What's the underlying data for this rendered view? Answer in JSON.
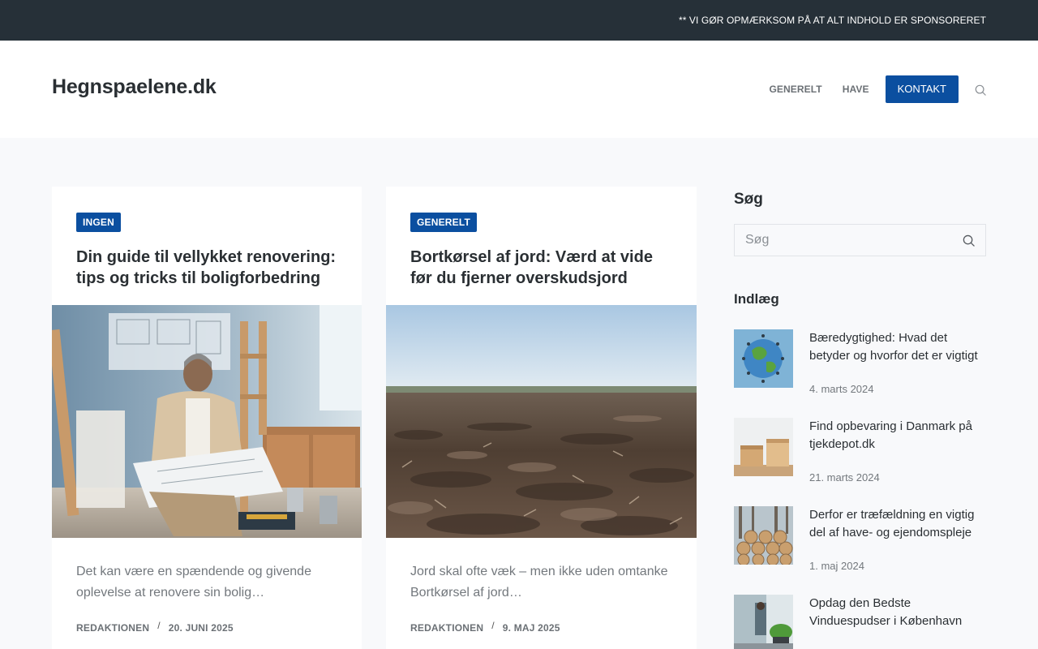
{
  "topbar": {
    "notice": "** VI GØR OPMÆRKSOM PÅ AT ALT INDHOLD ER SPONSORERET"
  },
  "header": {
    "logo": "Hegnspaelene.dk",
    "nav": [
      {
        "label": "GENERELT"
      },
      {
        "label": "HAVE"
      }
    ],
    "contact_label": "KONTAKT",
    "search_icon": "search-icon"
  },
  "posts": [
    {
      "category": "INGEN",
      "title": "Din guide til vellykket renovering: tips og tricks til boligforbedring",
      "excerpt": "Det kan være en spændende og givende oplevelse at renovere sin bolig…",
      "author": "REDAKTIONEN",
      "date": "20. JUNI 2025"
    },
    {
      "category": "GENERELT",
      "title": "Bortkørsel af jord: Værd at vide før du fjerner overskudsjord",
      "excerpt": "Jord skal ofte væk – men ikke uden omtanke Bortkørsel af jord…",
      "author": "REDAKTIONEN",
      "date": "9. MAJ 2025"
    }
  ],
  "sidebar": {
    "search_heading": "Søg",
    "search_placeholder": "Søg",
    "posts_heading": "Indlæg",
    "recent": [
      {
        "title": "Bæredygtighed: Hvad det betyder og hvorfor det er vigtigt",
        "date": "4. marts 2024"
      },
      {
        "title": "Find opbevaring i Danmark på tjekdepot.dk",
        "date": "21. marts 2024"
      },
      {
        "title": "Derfor er træfældning en vigtig del af have- og ejendomspleje",
        "date": "1. maj 2024"
      },
      {
        "title": "Opdag den Bedste Vinduespudser i København",
        "date": ""
      }
    ]
  },
  "colors": {
    "accent": "#0b4fa0",
    "topbar": "#263038"
  }
}
